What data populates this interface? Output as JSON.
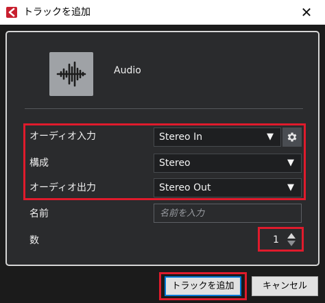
{
  "window": {
    "title": "トラックを追加",
    "close_glyph": "✕"
  },
  "track_type": {
    "label": "Audio",
    "icon": "audio-waveform-icon"
  },
  "fields": {
    "input": {
      "label": "オーディオ入力",
      "value": "Stereo In"
    },
    "config": {
      "label": "構成",
      "value": "Stereo"
    },
    "output": {
      "label": "オーディオ出力",
      "value": "Stereo Out"
    },
    "name": {
      "label": "名前",
      "placeholder": "名前を入力",
      "value": ""
    },
    "count": {
      "label": "数",
      "value": "1"
    }
  },
  "buttons": {
    "add": "トラックを追加",
    "cancel": "キャンセル"
  },
  "colors": {
    "highlight": "#e01b2c",
    "panel_bg": "#2a2b2d",
    "accent_focus": "#0078d7"
  }
}
